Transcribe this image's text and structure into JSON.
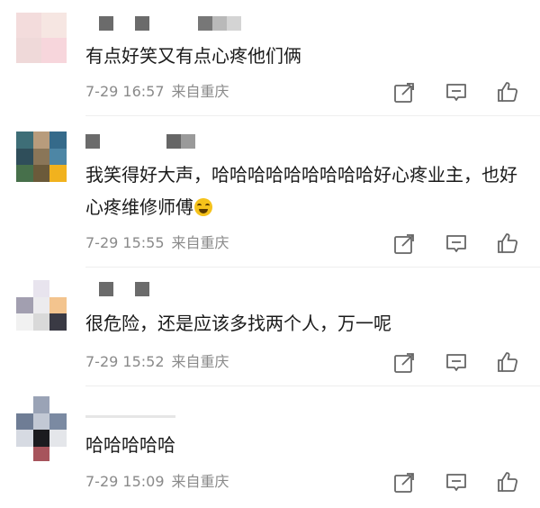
{
  "comments": [
    {
      "text": "有点好笑又有点心疼他们俩",
      "time": "7-29 16:57",
      "location": "来自重庆",
      "avatar_colors": [
        "#f3dcdc",
        "#f6e6e2",
        "#efd9d9",
        "#f7d6dc"
      ]
    },
    {
      "text": "我笑得好大声，哈哈哈哈哈哈哈哈哈好心疼业主，也好心疼维修师傅",
      "time": "7-29 15:55",
      "location": "来自重庆",
      "avatar_colors": [
        "#3e6e77",
        "#b89c7c",
        "#356a8a",
        "#47704b",
        "#6b5a3a",
        "#f1b21e"
      ]
    },
    {
      "text": "很危险，还是应该多找两个人，万一呢",
      "time": "7-29 15:52",
      "location": "来自重庆",
      "avatar_colors": [
        "#e8e4ee",
        "#a29fb0",
        "#f3c48e",
        "#d9d9d9",
        "#3a3a44"
      ]
    },
    {
      "text": "哈哈哈哈哈",
      "time": "7-29 15:09",
      "location": "来自重庆",
      "avatar_colors": [
        "#9aa3b6",
        "#6f7d95",
        "#c2c8d4",
        "#1b1b1f",
        "#a7545c"
      ]
    }
  ],
  "icons": {
    "share": "share-icon",
    "comment": "comment-icon",
    "like": "thumbs-up-icon"
  },
  "colors": {
    "text": "#1a1a1a",
    "meta": "#8a8a8a",
    "divider": "#eeeeee"
  }
}
